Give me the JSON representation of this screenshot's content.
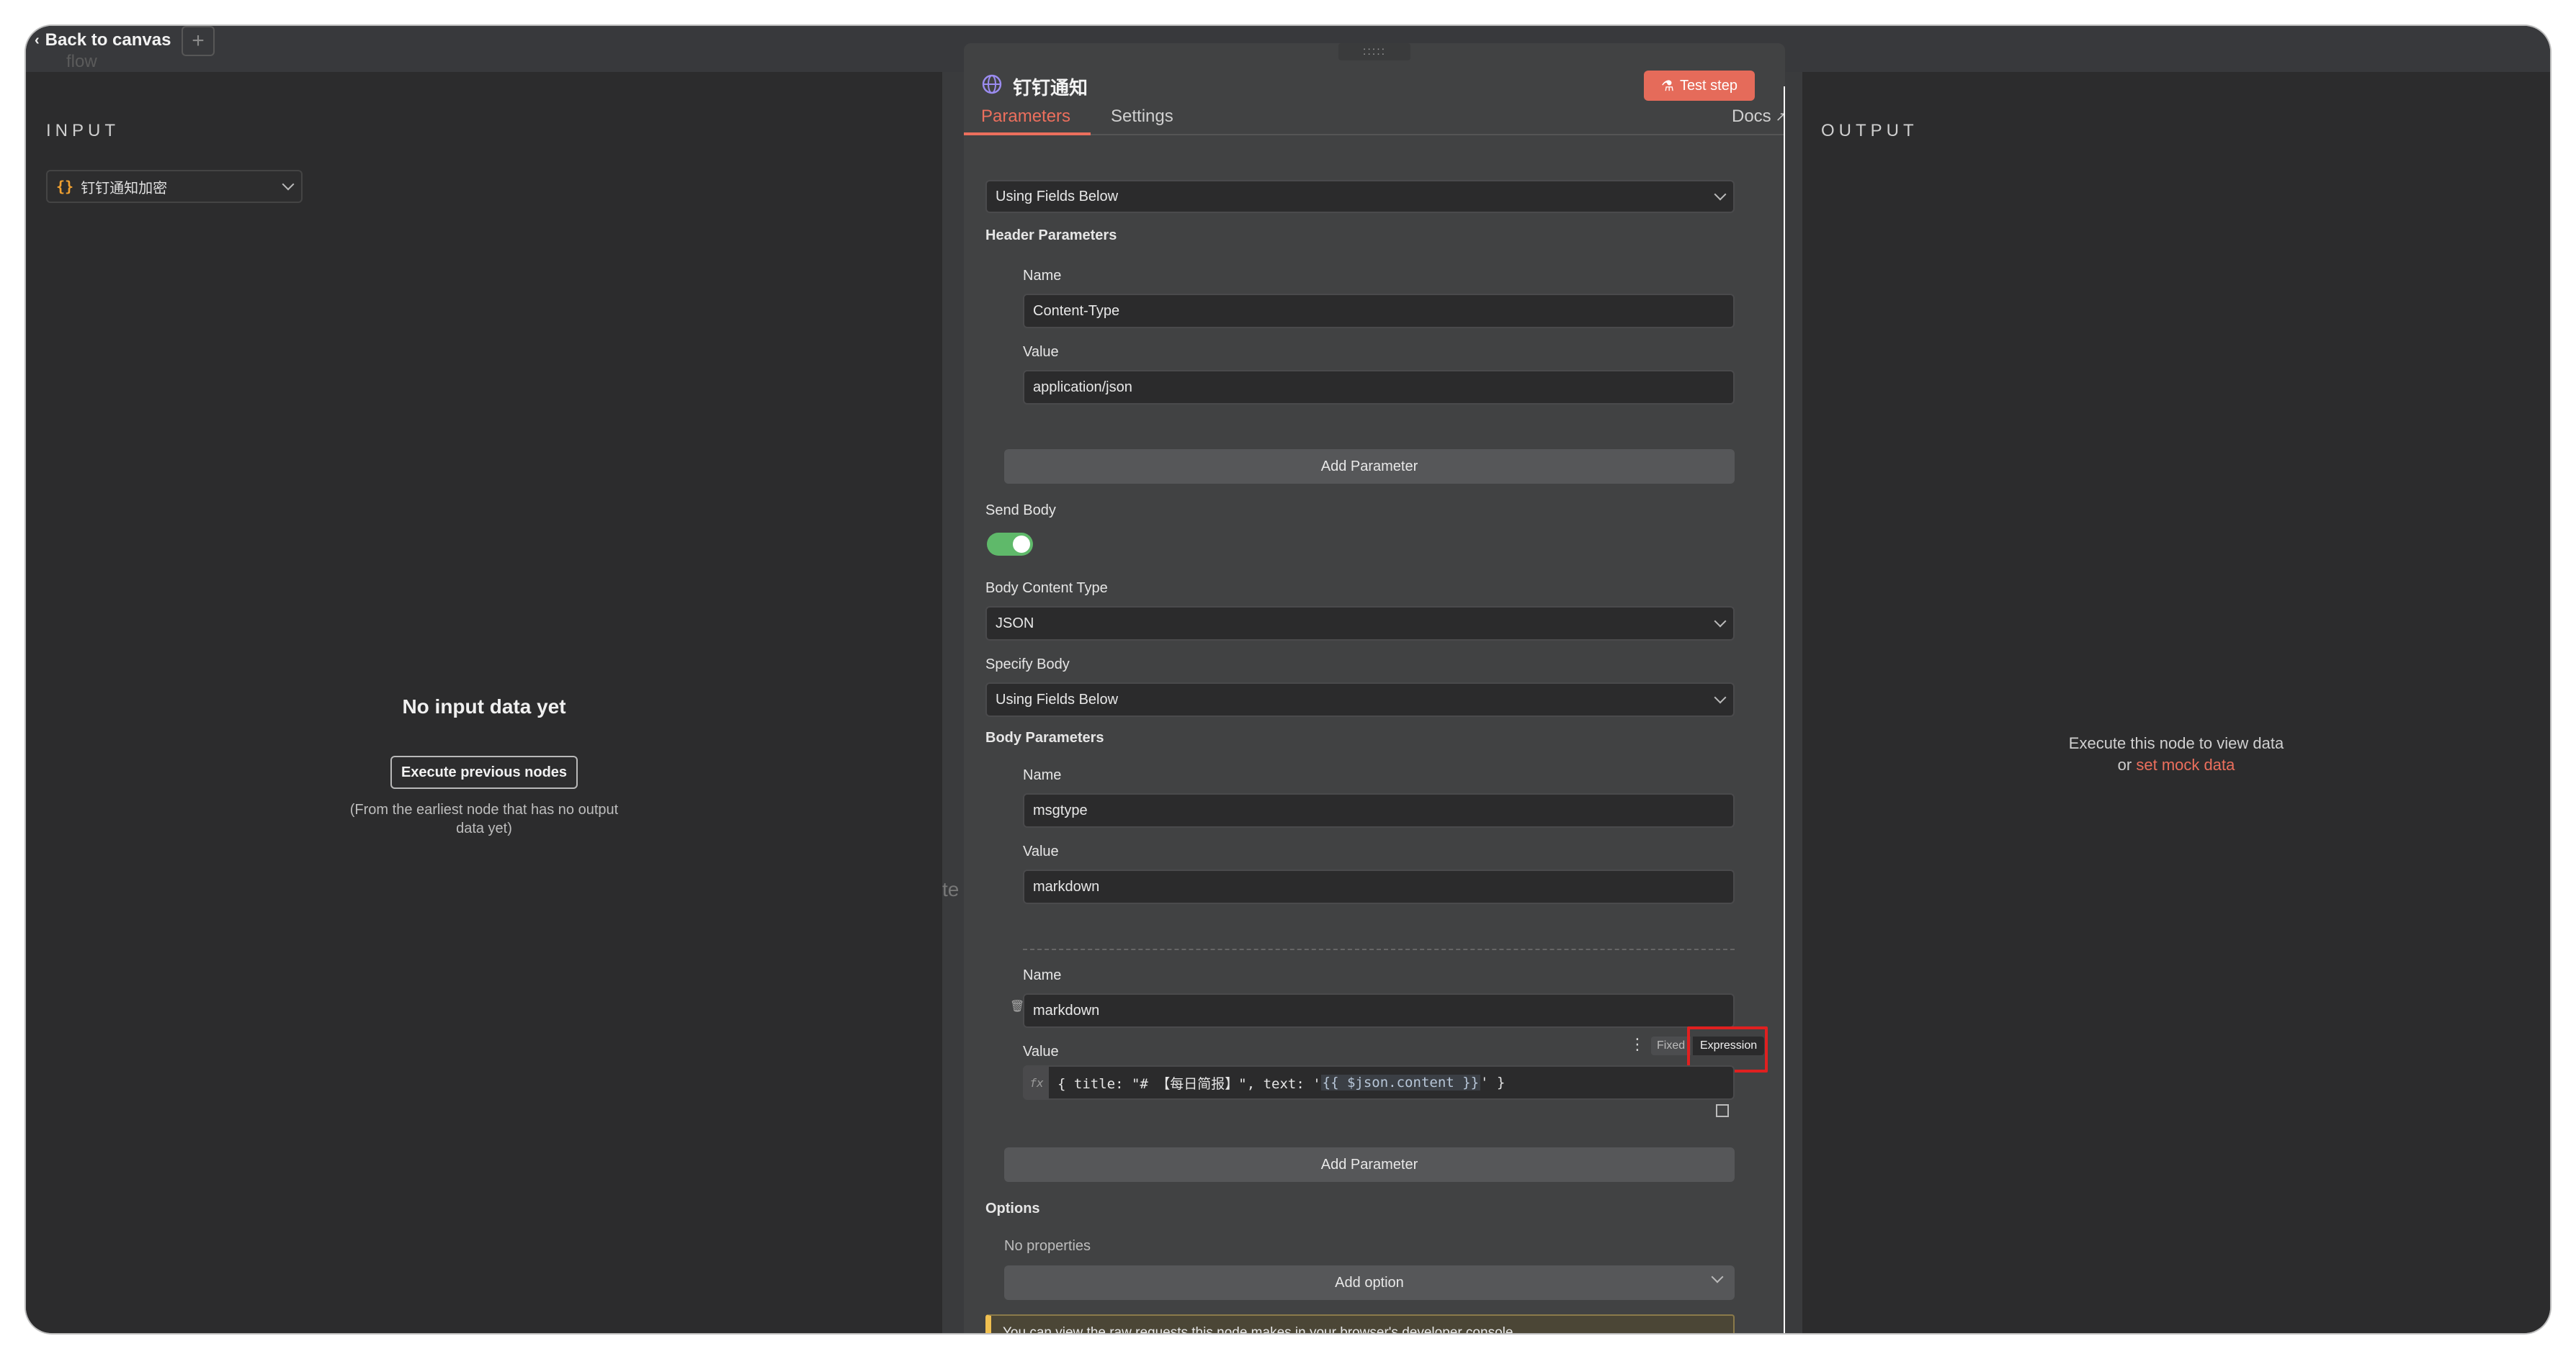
{
  "topbar": {
    "back_label": "Back to canvas",
    "ghost_text": "flow",
    "plus_label": "+"
  },
  "input_panel": {
    "title": "INPUT",
    "node_select": "钉钉通知加密",
    "empty_title": "No input data yet",
    "execute_button": "Execute previous nodes",
    "hint": "(From the earliest node that has no output data yet)",
    "canvas_fragment": "te"
  },
  "ndv": {
    "handle": ":::::",
    "title": "钉钉通知",
    "test_button": "Test step",
    "tabs": {
      "parameters": "Parameters",
      "settings": "Settings",
      "docs": "Docs"
    },
    "specify_headers_value": "Using Fields Below",
    "header_parameters_label": "Header Parameters",
    "header_params": [
      {
        "name_label": "Name",
        "name_value": "Content-Type",
        "value_label": "Value",
        "value_value": "application/json"
      }
    ],
    "add_parameter": "Add Parameter",
    "send_body_label": "Send Body",
    "send_body_on": true,
    "body_content_type_label": "Body Content Type",
    "body_content_type_value": "JSON",
    "specify_body_label": "Specify Body",
    "specify_body_value": "Using Fields Below",
    "body_parameters_label": "Body Parameters",
    "body_params": [
      {
        "name_label": "Name",
        "name_value": "msgtype",
        "value_label": "Value",
        "value_value": "markdown"
      },
      {
        "name_label": "Name",
        "name_value": "markdown",
        "value_label": "Value",
        "expr_prefix": "{ title: \"# 【每日简报】\", text: '",
        "expr_highlight": "{{ $json.content }}",
        "expr_suffix": "' }"
      }
    ],
    "fixed_label": "Fixed",
    "expression_label": "Expression",
    "fx_label": "fx",
    "options_label": "Options",
    "no_properties": "No properties",
    "add_option": "Add option",
    "warning": "You can view the raw requests this node makes in your browser's developer console"
  },
  "output_panel": {
    "title": "OUTPUT",
    "message_line1": "Execute this node to view data",
    "message_or": "or ",
    "mock_link": "set mock data"
  },
  "colors": {
    "accent": "#ec6f5d",
    "toggle_on": "#5fb96a",
    "highlight_box": "#e02020",
    "warning_border": "#f0c050"
  }
}
